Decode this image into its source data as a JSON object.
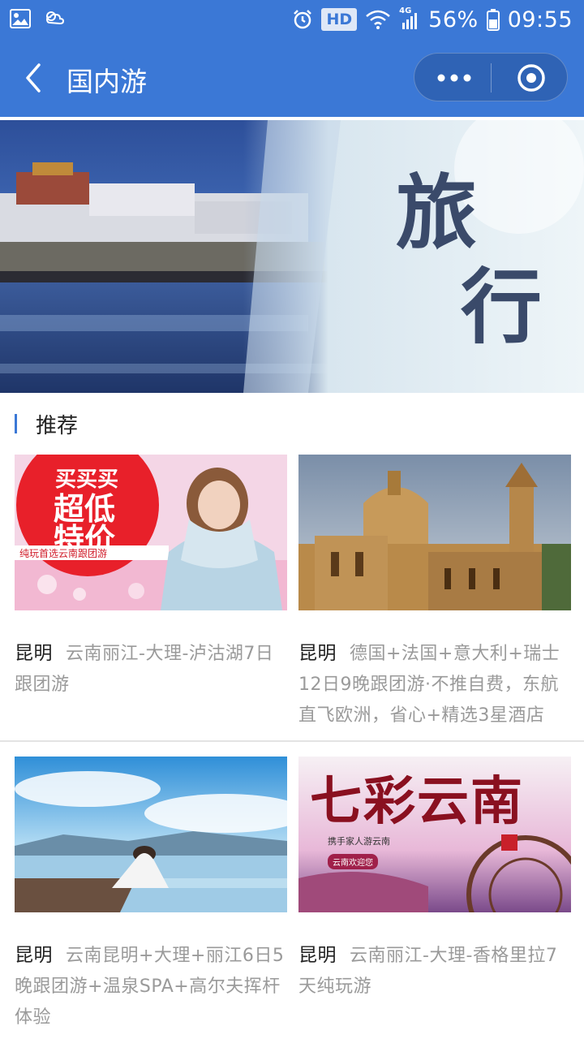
{
  "status_bar": {
    "hd_badge": "HD",
    "network": "4G",
    "battery": "56%",
    "time": "09:55"
  },
  "nav": {
    "title": "国内游"
  },
  "banner": {
    "text_line1": "旅",
    "text_line2": "行"
  },
  "section": {
    "title": "推荐"
  },
  "cards": [
    {
      "city": "昆明",
      "title": "云南丽江-大理-泸沽湖7日跟团游",
      "image_text": [
        "买买买",
        "超低",
        "特价",
        "纯玩首选云南跟团游"
      ]
    },
    {
      "city": "昆明",
      "title": "德国+法国+意大利+瑞士12日9晚跟团游·不推自费，东航直飞欧洲，省心+精选3星酒店",
      "image_text": []
    },
    {
      "city": "昆明",
      "title": "云南昆明+大理+丽江6日5晚跟团游+温泉SPA+高尔夫挥杆体验",
      "image_text": []
    },
    {
      "city": "昆明",
      "title": "云南丽江-大理-香格里拉7天纯玩游",
      "image_text": [
        "七彩云南",
        "携手家人游云南",
        "云南欢迎您"
      ]
    }
  ],
  "colors": {
    "primary": "#3b78d6",
    "capsule": "#2f63b5",
    "muted_text": "#9a9a9a"
  }
}
